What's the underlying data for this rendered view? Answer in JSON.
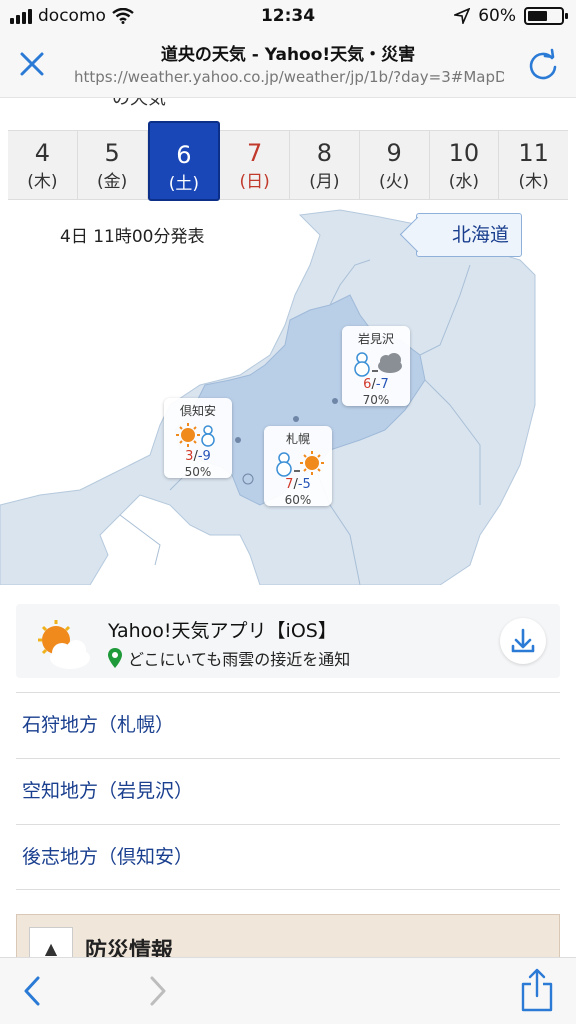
{
  "status": {
    "carrier": "docomo",
    "time": "12:34",
    "battery": "60%",
    "battery_level": 0.6
  },
  "browser": {
    "title": "道央の天気 - Yahoo!天気・災害",
    "url": "https://weather.yahoo.co.jp/weather/jp/1b/?day=3#MapD..."
  },
  "cropped_heading": "の天気",
  "date_tabs": [
    {
      "day": "4",
      "dow": "(木)"
    },
    {
      "day": "5",
      "dow": "(金)"
    },
    {
      "day": "6",
      "dow": "(土)"
    },
    {
      "day": "7",
      "dow": "(日)"
    },
    {
      "day": "8",
      "dow": "(月)"
    },
    {
      "day": "9",
      "dow": "(火)"
    },
    {
      "day": "10",
      "dow": "(水)"
    },
    {
      "day": "11",
      "dow": "(木)"
    }
  ],
  "map": {
    "issued": "4日 11時00分発表",
    "region_button": "北海道",
    "cities": [
      {
        "name": "岩見沢",
        "high": "6",
        "low": "-7",
        "pop": "70%",
        "icons": [
          "snow-icon",
          "cloud-icon"
        ]
      },
      {
        "name": "倶知安",
        "high": "3",
        "low": "-9",
        "pop": "50%",
        "icons": [
          "sun-icon",
          "snow-icon"
        ]
      },
      {
        "name": "札幌",
        "high": "7",
        "low": "-5",
        "pop": "60%",
        "icons": [
          "snow-icon",
          "sun-icon"
        ]
      }
    ]
  },
  "app_banner": {
    "title": "Yahoo!天気アプリ【iOS】",
    "subtitle": "どこにいても雨雲の接近を通知"
  },
  "region_links": [
    "石狩地方（札幌）",
    "空知地方（岩見沢）",
    "後志地方（倶知安）"
  ],
  "bousai": {
    "icon": "▲",
    "title": "防災情報"
  },
  "colors": {
    "accent": "#1a47b8",
    "link": "#1a3f8f",
    "ios_blue": "#2b7bd6",
    "high": "#d23a2a",
    "low": "#2554b8"
  }
}
